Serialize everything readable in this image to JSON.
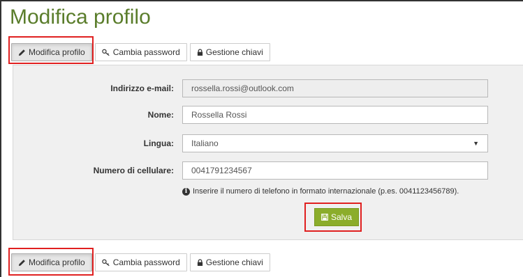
{
  "page": {
    "title": "Modifica profilo"
  },
  "tabs": [
    {
      "label": "Modifica profilo",
      "icon": "pencil-icon",
      "active": true
    },
    {
      "label": "Cambia password",
      "icon": "key-icon",
      "active": false
    },
    {
      "label": "Gestione chiavi",
      "icon": "lock-icon",
      "active": false
    }
  ],
  "form": {
    "email": {
      "label": "Indirizzo e-mail:",
      "value": "rossella.rossi@outlook.com"
    },
    "name": {
      "label": "Nome:",
      "value": "Rossella Rossi"
    },
    "language": {
      "label": "Lingua:",
      "value": "Italiano"
    },
    "phone": {
      "label": "Numero di cellulare:",
      "value": "0041791234567"
    },
    "hint": "Inserire il numero di telefono in formato internazionale (p.es. 0041123456789).",
    "save_label": "Salva"
  },
  "colors": {
    "title": "#5a7d2b",
    "save_button": "#8bad2b",
    "highlight": "#e02020",
    "panel": "#f0f0f0"
  }
}
